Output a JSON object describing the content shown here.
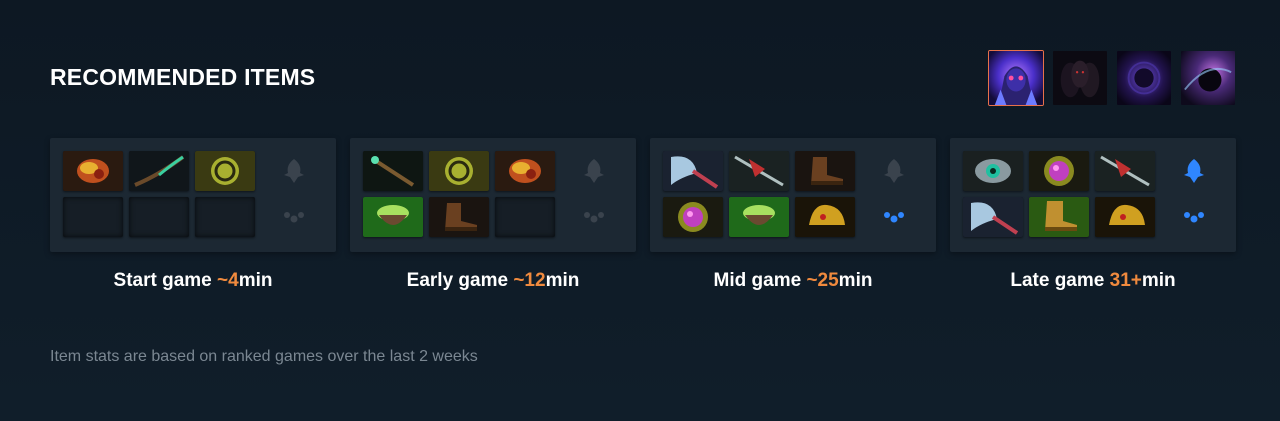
{
  "header": {
    "title": "RECOMMENDED ITEMS"
  },
  "heroes": [
    {
      "icon": "hero-portrait-icon",
      "selected": true
    },
    {
      "icon": "hero-portrait-icon",
      "selected": false
    },
    {
      "icon": "hero-portrait-icon",
      "selected": false
    },
    {
      "icon": "hero-portrait-icon",
      "selected": false
    }
  ],
  "phases": [
    {
      "label": "Start game ",
      "time": "~4",
      "unit": "min",
      "items": [
        "tango-icon",
        "branch-icon",
        "circlet-icon",
        "empty",
        "empty",
        "empty"
      ],
      "neutral_active": false
    },
    {
      "label": "Early game ",
      "time": "~12",
      "unit": "min",
      "items": [
        "wand-icon",
        "circlet-icon",
        "tango-icon",
        "mango-icon",
        "boots-icon",
        "empty"
      ],
      "neutral_active": false
    },
    {
      "label": "Mid game ",
      "time": "~25",
      "unit": "min",
      "items": [
        "axe-icon",
        "spear-icon",
        "boots-icon",
        "orb-icon",
        "mango-icon",
        "helm-icon"
      ],
      "neutral_active": true
    },
    {
      "label": "Late game ",
      "time": "31+",
      "unit": "min",
      "items": [
        "eye-icon",
        "orb-icon",
        "spear-icon",
        "axe-icon",
        "greaves-icon",
        "helm-icon"
      ],
      "neutral_active": true
    }
  ],
  "footnote": "Item stats are based on ranked games over the last 2 weeks",
  "colors": {
    "background": "#0f1b26",
    "panel": "#1c2833",
    "accent": "#f08a3e",
    "selected_border": "#e8714a",
    "footnote": "#7b8792"
  }
}
